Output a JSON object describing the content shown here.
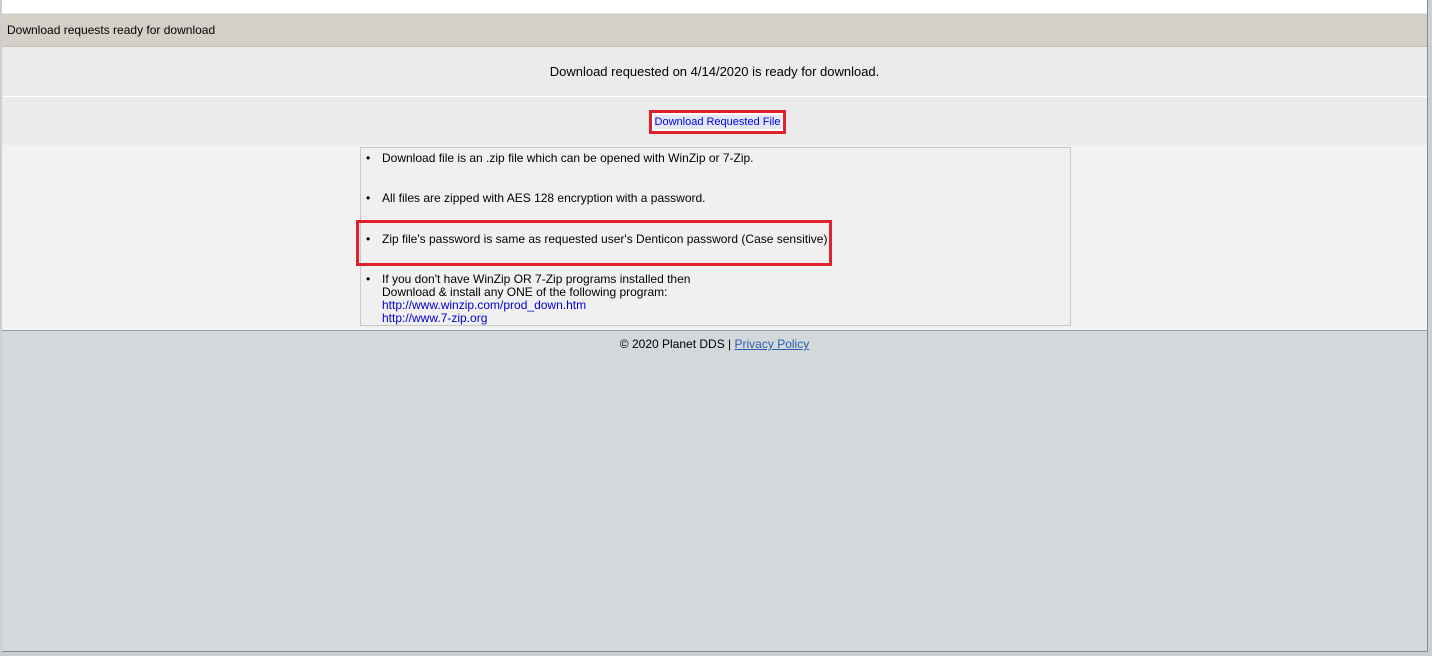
{
  "section": {
    "title": "Download requests ready for download"
  },
  "message": "Download requested on 4/14/2020 is ready for download.",
  "download_button": {
    "label": "Download Requested File"
  },
  "info": {
    "items": [
      "Download file is an .zip file which can be opened with WinZip or 7-Zip.",
      "All files are zipped with AES 128 encryption with a password.",
      "Zip file's password is same as requested user's Denticon password (Case sensitive)",
      "If you don't have WinZip OR 7-Zip programs installed then"
    ],
    "install_line": "Download & install any ONE of the following program:",
    "links": [
      "http://www.winzip.com/prod_down.htm",
      "http://www.7-zip.org"
    ]
  },
  "footer": {
    "copyright": "© 2020 Planet DDS",
    "separator": "|",
    "privacy_label": "Privacy Policy"
  },
  "colors": {
    "highlight": "#e0202a",
    "link": "#0000cc",
    "title_bar": "#d4d0c8"
  }
}
